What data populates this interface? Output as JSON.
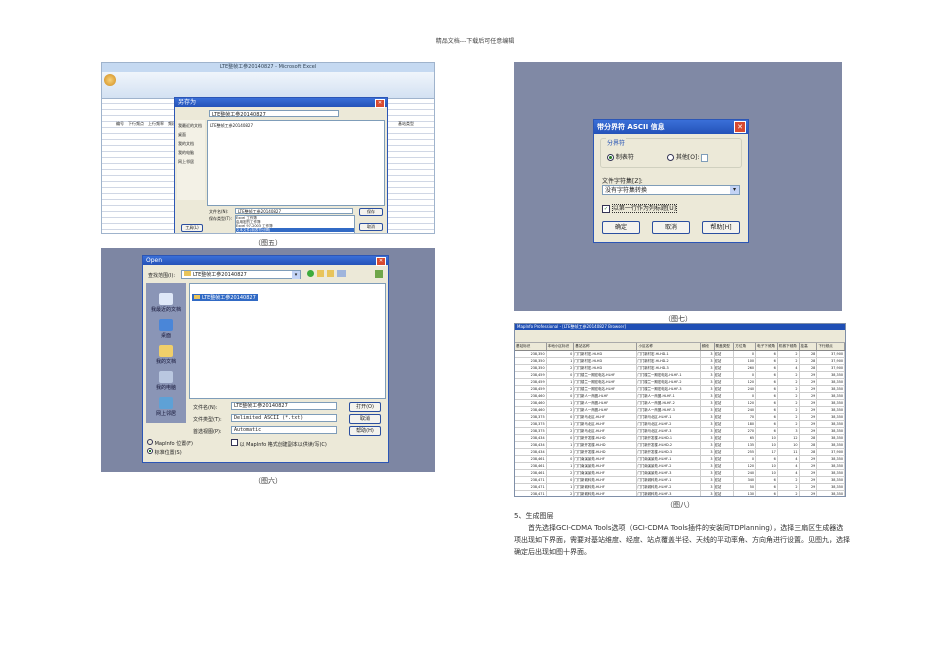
{
  "header": "精品文档---下载后可任意编辑",
  "captions": {
    "fig5": "（图五）",
    "fig6": "（图六）",
    "fig7": "（图七）",
    "fig8": "（图八）"
  },
  "fig5": {
    "excel_title": "LTE整帧工参20140827 - Microsoft Excel",
    "dialog_title": "另存为",
    "folder": "LTE整帧工参20140827",
    "file_item": "LTE整帧工参20140827",
    "places": [
      "我最近的文档",
      "桌面",
      "我的文档",
      "我的电脑",
      "网上邻居"
    ],
    "file_name_label": "文件名(N):",
    "file_name": "LTE整帧工参20140827",
    "type_label": "保存类型(T):",
    "types": [
      "Excel 工作簿",
      "启用宏的工作簿",
      "Excel 97-2003 工作簿",
      "文本文件(制表符分隔)"
    ],
    "tools": "工具(L)",
    "save": "保存",
    "cancel": "取消",
    "col_headers": [
      "编号",
      "下行频点",
      "上行频率",
      "频段",
      "基站类型"
    ]
  },
  "fig6": {
    "title": "Open",
    "look_in_label": "查找范围(I):",
    "look_in": "LTE整帧工参20140827",
    "file_item": "LTE整帧工参20140827",
    "places": [
      "我最近的文档",
      "桌面",
      "我的文档",
      "我的电脑",
      "网上邻居"
    ],
    "file_name_label": "文件名(N):",
    "file_name": "LTE整帧工参20140827",
    "type_label": "文件类型(T):",
    "type": "Delimited ASCII (*.txt)",
    "pref_label": "首选视图(P):",
    "pref": "Automatic",
    "open": "打开(O)",
    "cancel": "取消",
    "help": "帮助(H)",
    "checkbox": "以 MapInfo 格式创建副本以供读/写(C)",
    "radio1": "MapInfo 位置(F)",
    "radio2": "标准位置(S)"
  },
  "fig7": {
    "title": "带分界符 ASCII 信息",
    "group": "分界符",
    "tab": "制表符",
    "other": "其他[O]:",
    "charset_label": "文件字符集[Z]:",
    "charset": "没有字符集转换",
    "checkbox": "以第一行作为列标题[U]",
    "ok": "确定",
    "cancel": "取消",
    "help": "帮助[H]"
  },
  "fig8": {
    "title": "MapInfo Professional - [LTE整帧工参20140827 Browser]",
    "headers": [
      "基站标识",
      "本地小区标识",
      "基站名称",
      "小区名称",
      "频段",
      "覆盖类型",
      "方位角",
      "电子下倾角",
      "机械下倾角",
      "挂高",
      "下行频点"
    ],
    "rows": [
      [
        "238,350",
        "0",
        "门门新村宏-HLHD",
        "门门新村宏-HLHD-1",
        "3",
        "宏站",
        "0",
        "6",
        "2",
        "28",
        "37,900"
      ],
      [
        "238,350",
        "1",
        "门门新村宏-HLHD",
        "门门新村宏-HLHD-2",
        "3",
        "宏站",
        "100",
        "6",
        "2",
        "28",
        "37,900"
      ],
      [
        "238,350",
        "2",
        "门门新村宏-HLHD",
        "门门新村宏-HLHD-3",
        "3",
        "宏站",
        "260",
        "6",
        "4",
        "28",
        "37,900"
      ],
      [
        "238,459",
        "0",
        "门门楼兰一期宏电站-HLHF",
        "门门楼兰一期宏电站-HLHF-1",
        "3",
        "宏站",
        "0",
        "6",
        "2",
        "29",
        "38,350"
      ],
      [
        "238,459",
        "1",
        "门门楼兰一期宏电站-HLHF",
        "门门楼兰一期宏电站-HLHF-2",
        "3",
        "宏站",
        "120",
        "6",
        "2",
        "29",
        "38,350"
      ],
      [
        "238,459",
        "2",
        "门门楼兰一期宏电站-HLHF",
        "门门楼兰一期宏电站-HLHF-3",
        "3",
        "宏站",
        "240",
        "6",
        "2",
        "29",
        "38,350"
      ],
      [
        "238,460",
        "0",
        "门门新人一商圈-HLHF",
        "门门新人一商圈-HLHF-1",
        "3",
        "宏站",
        "0",
        "6",
        "2",
        "29",
        "38,350"
      ],
      [
        "238,460",
        "1",
        "门门新人一商圈-HLHF",
        "门门新人一商圈-HLHF-2",
        "3",
        "宏站",
        "120",
        "6",
        "2",
        "29",
        "38,350"
      ],
      [
        "238,460",
        "2",
        "门门新人一商圈-HLHF",
        "门门新人一商圈-HLHF-3",
        "3",
        "宏站",
        "240",
        "6",
        "2",
        "29",
        "38,350"
      ],
      [
        "238,375",
        "0",
        "门门新马北区-HLHF",
        "门门新马北区-HLHF-1",
        "3",
        "宏站",
        "70",
        "6",
        "2",
        "29",
        "38,350"
      ],
      [
        "238,375",
        "1",
        "门门新马北区-HLHF",
        "门门新马北区-HLHF-2",
        "3",
        "宏站",
        "180",
        "6",
        "2",
        "29",
        "38,350"
      ],
      [
        "238,375",
        "2",
        "门门新马北区-HLHF",
        "门门新马北区-HLHF-3",
        "3",
        "宏站",
        "270",
        "6",
        "3",
        "29",
        "38,350"
      ],
      [
        "238,434",
        "0",
        "门门新开发楼-HLHD",
        "门门新开发楼-HLHD-1",
        "3",
        "宏站",
        "65",
        "10",
        "12",
        "28",
        "38,350"
      ],
      [
        "238,434",
        "1",
        "门门新开发楼-HLHD",
        "门门新开发楼-HLHD-2",
        "3",
        "宏站",
        "135",
        "10",
        "10",
        "28",
        "38,350"
      ],
      [
        "238,434",
        "2",
        "门门新开发楼-HLHD",
        "门门新开发楼-HLHD-3",
        "3",
        "宏站",
        "255",
        "17",
        "11",
        "28",
        "37,900"
      ],
      [
        "238,461",
        "0",
        "门门南溪景苑-HLHF",
        "门门南溪景苑-HLHF-1",
        "3",
        "宏站",
        "0",
        "6",
        "4",
        "29",
        "38,350"
      ],
      [
        "238,461",
        "1",
        "门门南溪景苑-HLHF",
        "门门南溪景苑-HLHF-2",
        "3",
        "宏站",
        "120",
        "10",
        "4",
        "29",
        "38,350"
      ],
      [
        "238,461",
        "2",
        "门门南溪景苑-HLHF",
        "门门南溪景苑-HLHF-3",
        "3",
        "宏站",
        "240",
        "10",
        "4",
        "29",
        "38,350"
      ],
      [
        "238,471",
        "0",
        "门门新城科苑-HLHF",
        "门门新城科苑-HLHF-1",
        "3",
        "宏站",
        "340",
        "6",
        "2",
        "29",
        "38,350"
      ],
      [
        "238,471",
        "1",
        "门门新城科苑-HLHF",
        "门门新城科苑-HLHF-2",
        "3",
        "宏站",
        "50",
        "6",
        "2",
        "29",
        "38,350"
      ],
      [
        "238,471",
        "2",
        "门门新城科苑-HLHF",
        "门门新城科苑-HLHF-3",
        "3",
        "宏站",
        "130",
        "6",
        "2",
        "29",
        "38,350"
      ],
      [
        "238,462",
        "0",
        "门门博雅佳苑-HLHF",
        "门门博雅佳苑-HLHF-1",
        "3",
        "宏站",
        "0",
        "6",
        "2",
        "29",
        "38,350"
      ],
      [
        "238,462",
        "1",
        "门门博雅佳苑-HLHF",
        "门门博雅佳苑-HLHF-2",
        "3",
        "宏站",
        "120",
        "6",
        "2",
        "29",
        "38,350"
      ],
      [
        "238,462",
        "2",
        "门门博雅佳苑-HLHF",
        "门门博雅佳苑-HLHF-3",
        "3",
        "宏站",
        "240",
        "6",
        "2",
        "29",
        "38,350"
      ]
    ]
  },
  "section": {
    "heading": "5、生成图层",
    "paragraph": "首先选择GCI-CDMA Tools选项（GCI-CDMA Tools插件的安装同TDPlanning），选择三扇区生成器选项出现如下界面，需要对基站维度、经度、站点覆盖半径、天线的平动率角、方向角进行设置。见图九，选择确定后出现如图十界面。"
  }
}
